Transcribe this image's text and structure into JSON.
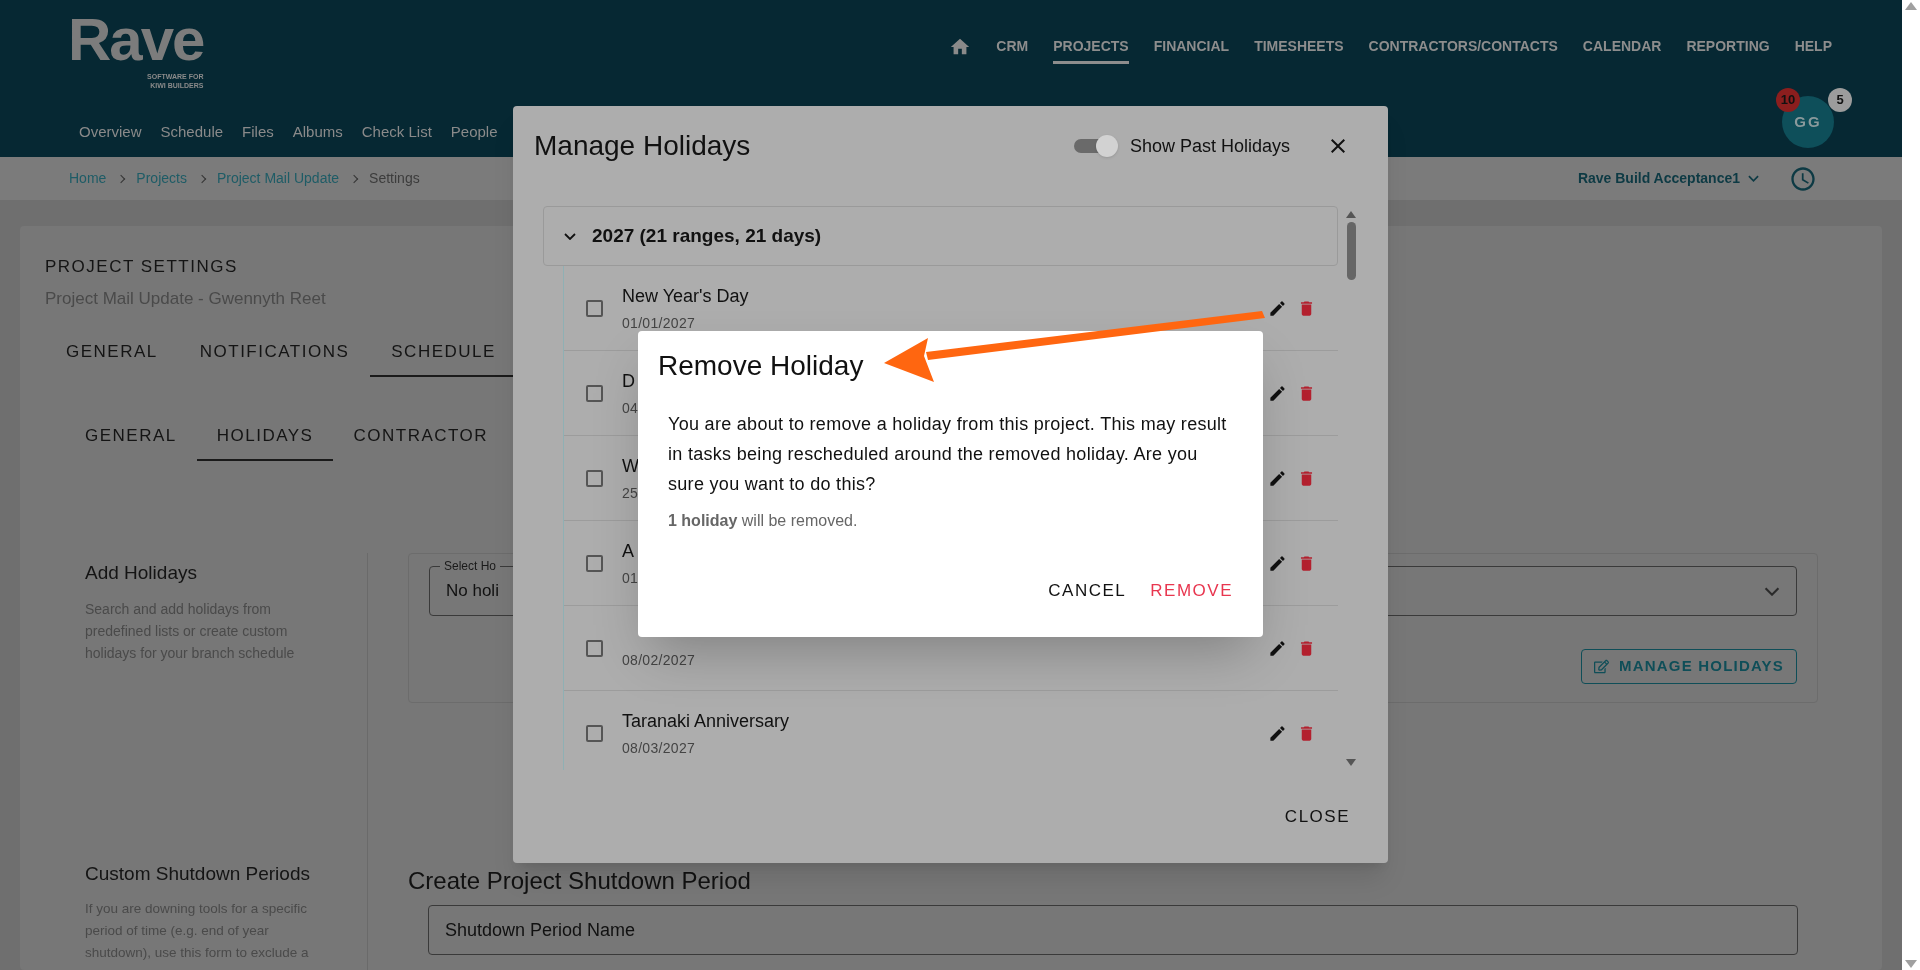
{
  "header": {
    "logo": "Rave",
    "tagline": [
      "SOFTWARE FOR",
      "KIWI BUILDERS"
    ],
    "nav": [
      {
        "label": "CRM",
        "selected": false
      },
      {
        "label": "PROJECTS",
        "selected": true
      },
      {
        "label": "FINANCIAL",
        "selected": false
      },
      {
        "label": "TIMESHEETS",
        "selected": false
      },
      {
        "label": "CONTRACTORS/CONTACTS",
        "selected": false
      },
      {
        "label": "CALENDAR",
        "selected": false
      },
      {
        "label": "REPORTING",
        "selected": false
      },
      {
        "label": "HELP",
        "selected": false
      }
    ],
    "subnav": [
      "Overview",
      "Schedule",
      "Files",
      "Albums",
      "Check List",
      "People"
    ],
    "avatar": {
      "initials": "GG",
      "badges": [
        {
          "text": "10",
          "color": "#8b1e1e"
        },
        {
          "text": "5",
          "color": "#9c9c9c"
        }
      ]
    }
  },
  "breadcrumb": {
    "links": [
      "Home",
      "Projects",
      "Project Mail Update"
    ],
    "current": "Settings",
    "branch": "Rave Build Acceptance1"
  },
  "settings": {
    "title": "PROJECT SETTINGS",
    "subtitle": "Project Mail Update - Gwennyth Reet",
    "tabs": [
      {
        "label": "GENERAL",
        "selected": false
      },
      {
        "label": "NOTIFICATIONS",
        "selected": false
      },
      {
        "label": "SCHEDULE",
        "selected": true
      }
    ],
    "subtabs": [
      {
        "label": "GENERAL",
        "selected": false
      },
      {
        "label": "HOLIDAYS",
        "selected": true
      },
      {
        "label": "CONTRACTOR",
        "selected": false
      }
    ],
    "add_holidays": {
      "title": "Add Holidays",
      "description": "Search and add holidays from predefined lists or create custom holidays for your branch schedule",
      "select_label": "Select Ho",
      "select_value": "No holi",
      "button": "MANAGE HOLIDAYS"
    },
    "shutdown": {
      "title": "Custom Shutdown Periods",
      "description": "If you are downing tools for a specific period of time (e.g. end of year shutdown), use this form to exclude a",
      "form_title": "Create Project Shutdown Period",
      "placeholder": "Shutdown Period Name"
    }
  },
  "manage_dialog": {
    "title": "Manage Holidays",
    "toggle": {
      "label": "Show Past Holidays",
      "on": true
    },
    "group": {
      "label": "2027 (21 ranges, 21 days)",
      "expanded": true
    },
    "holidays": [
      {
        "name": "New Year's Day",
        "date": "01/01/2027",
        "checked": false
      },
      {
        "name": "D",
        "date": "04",
        "checked": false
      },
      {
        "name": "W",
        "date": "25",
        "checked": false
      },
      {
        "name": "A",
        "date": "01",
        "checked": false
      },
      {
        "date": "08/02/2027",
        "checked": false
      },
      {
        "name": "Taranaki Anniversary",
        "date": "08/03/2027",
        "checked": false
      }
    ],
    "close": "CLOSE"
  },
  "remove_dialog": {
    "title": "Remove Holiday",
    "message": "You are about to remove a holiday from this project. This may result in tasks being rescheduled around the removed holiday. Are you sure you want to do this?",
    "note": "**1 holiday** will be removed.",
    "buttons": [
      {
        "label": "CANCEL",
        "kind": "cancel"
      },
      {
        "label": "REMOVE",
        "kind": "danger"
      }
    ]
  }
}
